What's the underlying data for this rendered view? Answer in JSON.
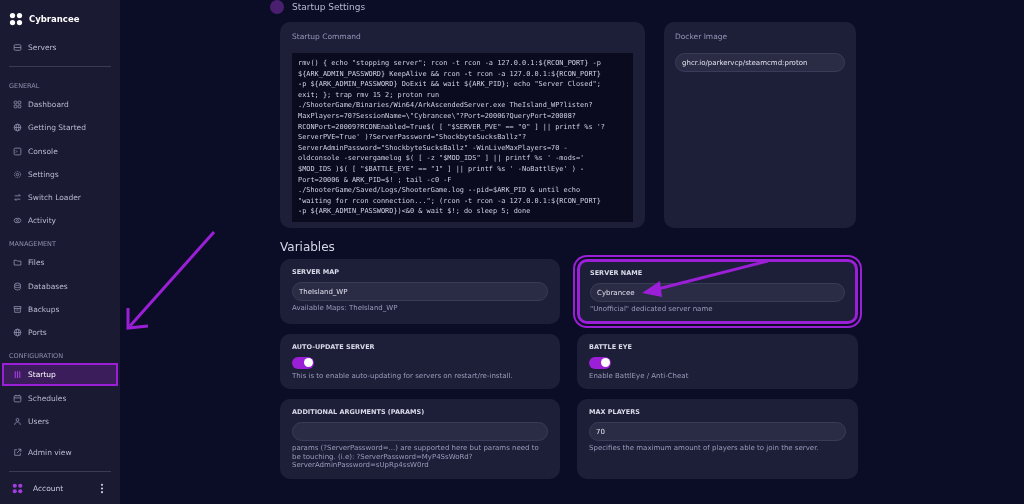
{
  "brand": {
    "name": "Cybrancee"
  },
  "sidebar": {
    "top_items": [
      {
        "label": "Servers",
        "selected": false
      }
    ],
    "sections": [
      {
        "title": "GENERAL",
        "items": [
          {
            "label": "Dashboard",
            "selected": false
          },
          {
            "label": "Getting Started",
            "selected": false
          },
          {
            "label": "Console",
            "selected": false
          },
          {
            "label": "Settings",
            "selected": false
          },
          {
            "label": "Switch Loader",
            "selected": false
          },
          {
            "label": "Activity",
            "selected": false
          }
        ]
      },
      {
        "title": "MANAGEMENT",
        "items": [
          {
            "label": "Files",
            "selected": false
          },
          {
            "label": "Databases",
            "selected": false
          },
          {
            "label": "Backups",
            "selected": false
          },
          {
            "label": "Ports",
            "selected": false
          }
        ]
      },
      {
        "title": "CONFIGURATION",
        "items": [
          {
            "label": "Startup",
            "selected": true,
            "highlighted": true
          },
          {
            "label": "Schedules",
            "selected": false
          },
          {
            "label": "Users",
            "selected": false
          }
        ]
      }
    ],
    "admin_link": "Admin view",
    "account": "Account"
  },
  "page": {
    "title": "Startup Settings",
    "startup_command": {
      "label": "Startup Command",
      "command": "rmv() { echo \"stopping server\"; rcon -t rcon -a 127.0.0.1:${RCON_PORT} -p\n${ARK_ADMIN_PASSWORD} KeepAlive && rcon -t rcon -a 127.0.0.1:${RCON_PORT}\n-p ${ARK_ADMIN_PASSWORD} DoExit && wait ${ARK_PID}; echo \"Server Closed\";\nexit; }; trap rmv 15 2; proton run\n./ShooterGame/Binaries/Win64/ArkAscendedServer.exe TheIsland_WP?listen?\nMaxPlayers=70?SessionName=\\\"Cybrancee\\\"?Port=20006?QueryPort=20008?\nRCONPort=20009?RCONEnabled=True$( [ \"$SERVER_PVE\" == \"0\" ] || printf %s '?\nServerPVE=True' )?ServerPassword=\"ShockbyteSucksBallz\"?\nServerAdminPassword=\"ShockbyteSucksBallz\" -WinLiveMaxPlayers=70 -\noldconsole -servergamelog $( [ -z \"$MOD_IDS\" ] || printf %s ' -mods='\n$MOD_IDS )$( [ \"$BATTLE_EYE\" == \"1\" ] || printf %s ' -NoBattlEye' ) -\nPort=20006 & ARK_PID=$! ; tail -c0 -F\n./ShooterGame/Saved/Logs/ShooterGame.log --pid=$ARK_PID & until echo\n\"waiting for rcon connection...\"; (rcon -t rcon -a 127.0.0.1:${RCON_PORT}\n-p ${ARK_ADMIN_PASSWORD})<&0 & wait $!; do sleep 5; done"
    },
    "docker_image": {
      "label": "Docker Image",
      "value": "ghcr.io/parkervcp/steamcmd:proton"
    },
    "variables_title": "Variables",
    "variables": [
      {
        "kind": "text",
        "label": "SERVER MAP",
        "value": "TheIsland_WP",
        "description": "Available Maps: TheIsland_WP",
        "highlighted": false
      },
      {
        "kind": "text",
        "label": "SERVER NAME",
        "value": "Cybrancee",
        "description": "\"Unofficial\" dedicated server name",
        "highlighted": true
      },
      {
        "kind": "toggle",
        "label": "AUTO-UPDATE SERVER",
        "on": true,
        "description": "This is to enable auto-updating for servers on restart/re-install.",
        "highlighted": false
      },
      {
        "kind": "toggle",
        "label": "BATTLE EYE",
        "on": true,
        "description": "Enable BattlEye / Anti-Cheat",
        "highlighted": false
      },
      {
        "kind": "text",
        "label": "ADDITIONAL ARGUMENTS (PARAMS)",
        "description": "params (?ServerPassword=...) are supported here but params need to be touching. (i.e): ?ServerPassword=MyP4SsWoRd?ServerAdminPassword=sUpRp4ssW0rd",
        "highlighted": false
      },
      {
        "kind": "text",
        "label": "MAX PLAYERS",
        "value": "70",
        "description": "Specifies the maximum amount of players able to join the server.",
        "highlighted": false
      }
    ]
  }
}
